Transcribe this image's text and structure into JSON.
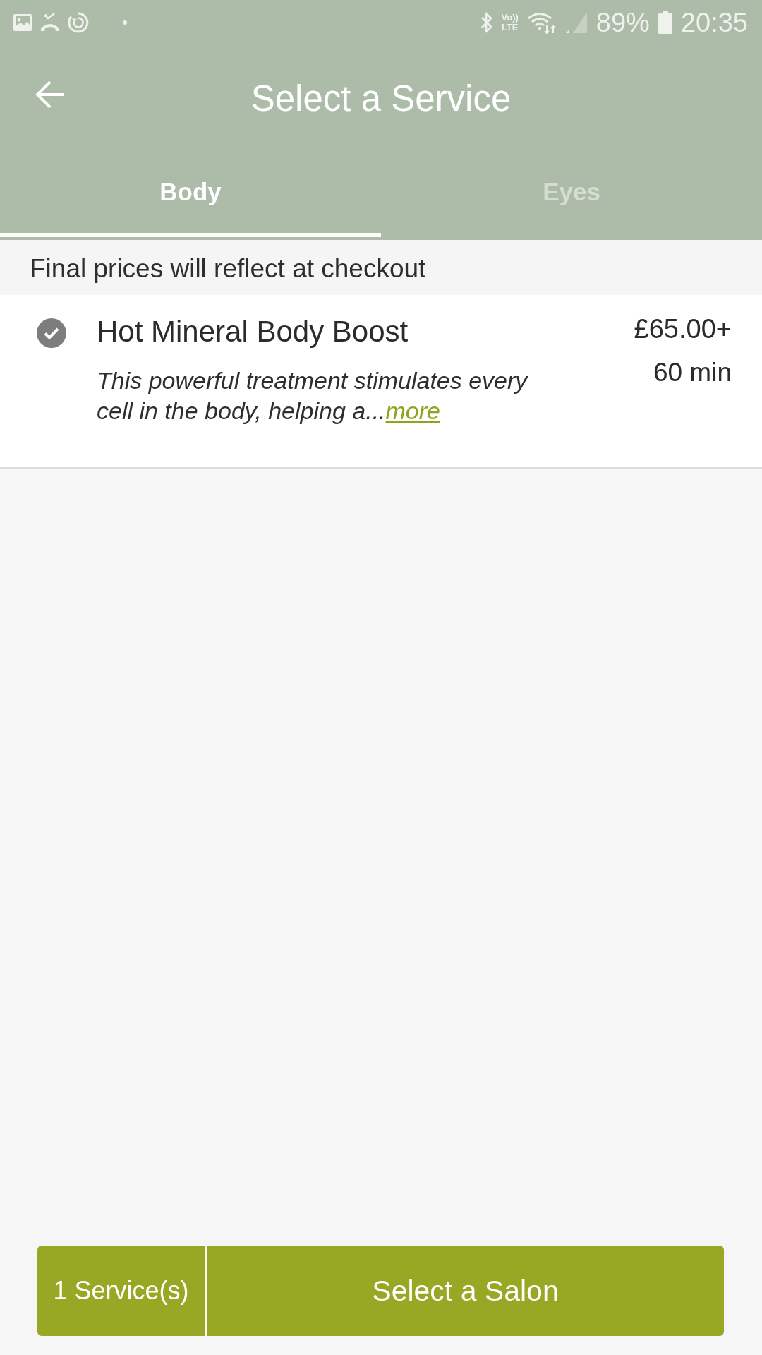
{
  "status_bar": {
    "volte_badge": {
      "top": "Vo))",
      "bottom": "LTE"
    },
    "battery": "89%",
    "time": "20:35"
  },
  "header": {
    "title": "Select a Service"
  },
  "tabs": [
    {
      "label": "Body",
      "selected": true
    },
    {
      "label": "Eyes",
      "selected": false
    }
  ],
  "notice": "Final prices will reflect at checkout",
  "services": [
    {
      "name": "Hot Mineral Body Boost",
      "selected": true,
      "price": "£65.00+",
      "duration": "60 min",
      "description": "This powerful treatment stimulates every cell in the body, helping a...",
      "more_link": "more"
    }
  ],
  "footer": {
    "count": "1 Service(s)",
    "action": "Select a Salon"
  }
}
